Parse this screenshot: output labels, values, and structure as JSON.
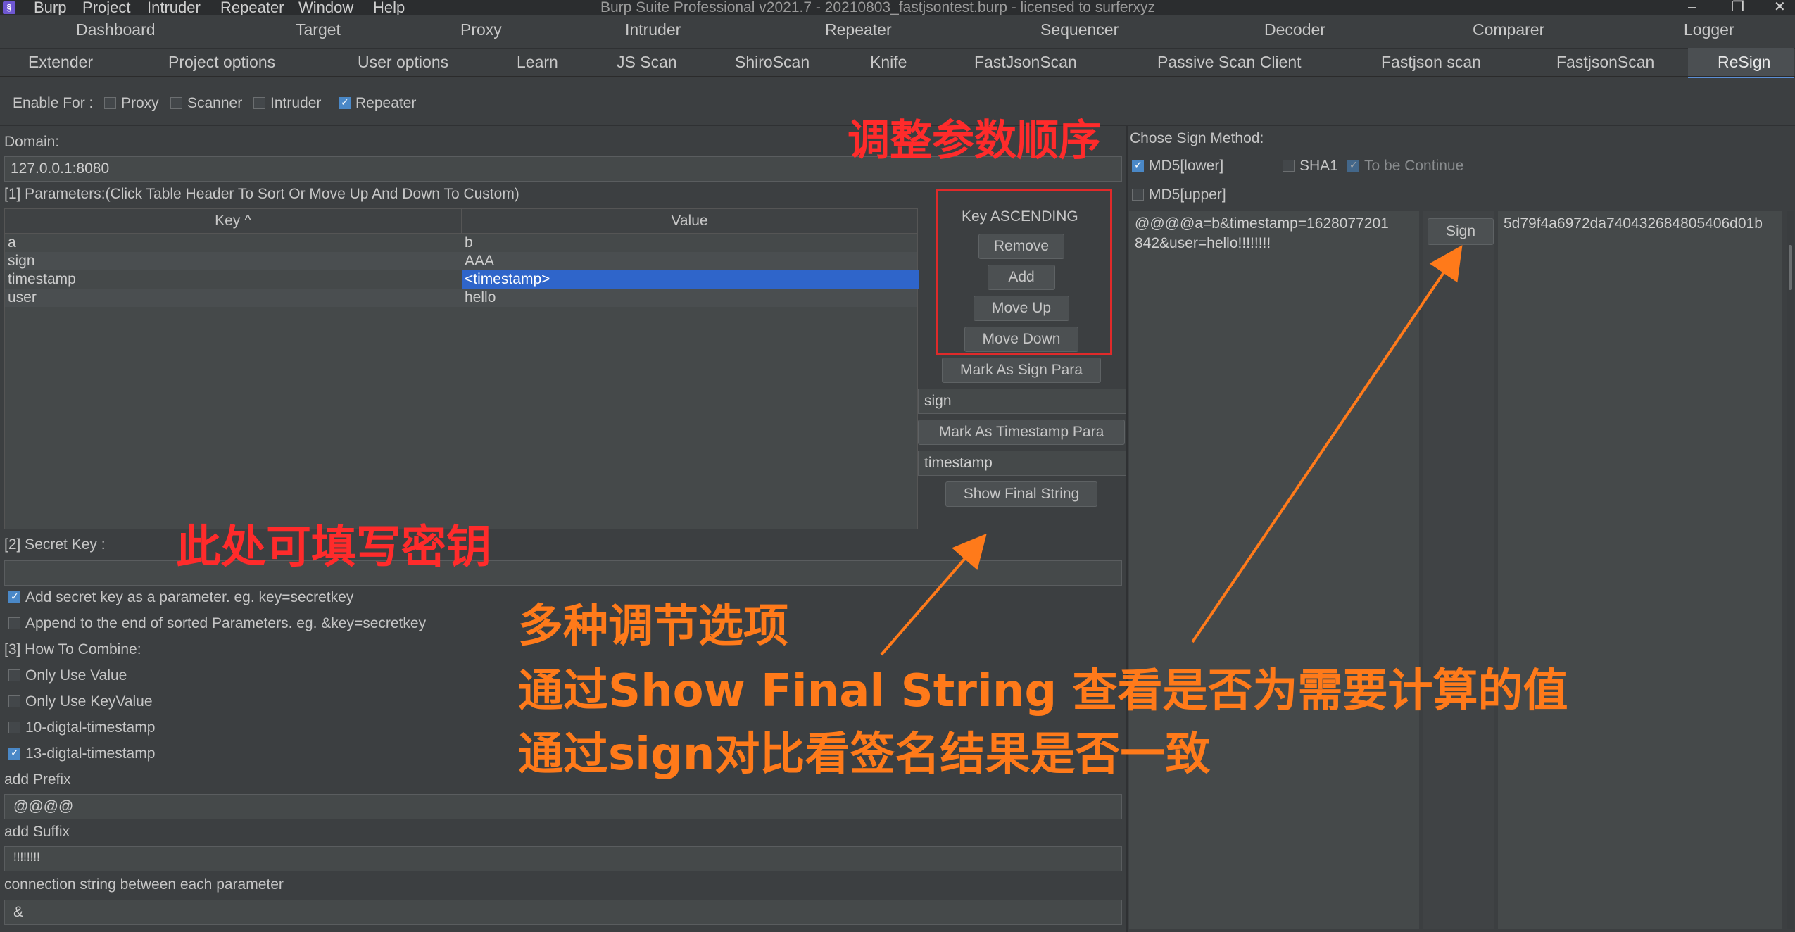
{
  "app": {
    "menu": [
      "Burp",
      "Project",
      "Intruder",
      "Repeater",
      "Window",
      "Help"
    ],
    "title": "Burp Suite Professional v2021.7 - 20210803_fastjsontest.burp - licensed to surferxyz",
    "window_controls": [
      "–",
      "❐",
      "✕"
    ]
  },
  "tabs_row1": [
    "Dashboard",
    "Target",
    "Proxy",
    "Intruder",
    "Repeater",
    "Sequencer",
    "Decoder",
    "Comparer",
    "Logger"
  ],
  "tabs_row2": [
    "Extender",
    "Project options",
    "User options",
    "Learn",
    "JS Scan",
    "ShiroScan",
    "Knife",
    "FastJsonScan",
    "Passive Scan Client",
    "Fastjson scan",
    "FastjsonScan",
    "ReSign"
  ],
  "enable_for": {
    "label": "Enable For :",
    "options": [
      {
        "label": "Proxy",
        "checked": false
      },
      {
        "label": "Scanner",
        "checked": false
      },
      {
        "label": "Intruder",
        "checked": false
      },
      {
        "label": "Repeater",
        "checked": true
      }
    ]
  },
  "domain": {
    "label": "Domain:",
    "value": "127.0.0.1:8080"
  },
  "parameters": {
    "label": "[1] Parameters:(Click Table Header To Sort Or Move Up And Down To Custom)",
    "columns": [
      "Key ^",
      "Value"
    ],
    "rows": [
      {
        "key": "a",
        "value": "b"
      },
      {
        "key": "sign",
        "value": "AAA"
      },
      {
        "key": "timestamp",
        "value": "<timestamp>"
      },
      {
        "key": "user",
        "value": "hello"
      }
    ]
  },
  "side_controls": {
    "sort_label": "Key ASCENDING",
    "remove": "Remove",
    "add": "Add",
    "move_up": "Move Up",
    "move_down": "Move Down",
    "mark_sign": "Mark As Sign Para",
    "sign_para": "sign",
    "mark_timestamp": "Mark As Timestamp Para",
    "timestamp_para": "timestamp",
    "show_final": "Show Final String"
  },
  "secret": {
    "label": "[2] Secret Key :",
    "value": "",
    "opt_param": {
      "label": "Add secret key as a parameter. eg. key=secretkey",
      "checked": true
    },
    "opt_append": {
      "label": "Append to the end of sorted Parameters. eg. &key=secretkey",
      "checked": false
    }
  },
  "combine": {
    "label": "[3] How To Combine:",
    "options": [
      {
        "label": "Only Use Value",
        "checked": false
      },
      {
        "label": "Only Use KeyValue",
        "checked": false
      },
      {
        "label": "10-digtal-timestamp",
        "checked": false
      },
      {
        "label": "13-digtal-timestamp",
        "checked": true
      }
    ],
    "prefix_label": "add Prefix",
    "prefix_value": "@@@@",
    "suffix_label": "add Suffix",
    "suffix_value": "!!!!!!!!",
    "conn_label": "connection string between each parameter",
    "conn_value": "&"
  },
  "sign_method": {
    "label": "Chose Sign Method:",
    "options": [
      {
        "label": "MD5[lower]",
        "checked": true
      },
      {
        "label": "SHA1",
        "checked": false
      },
      {
        "label": "To be Continue",
        "checked": true
      },
      {
        "label": "MD5[upper]",
        "checked": false
      }
    ],
    "final_string_line1": "@@@@a=b&timestamp=1628077201",
    "final_string_line2": "842&user=hello!!!!!!!!",
    "sign_button": "Sign",
    "result": "5d79f4a6972da740432684805406d01b"
  },
  "annotations": {
    "order": "调整参数顺序",
    "secret": "此处可填写密钥",
    "line1": "多种调节选项",
    "line2": "通过Show Final String 查看是否为需要计算的值",
    "line3": "通过sign对比看签名结果是否一致"
  },
  "colors": {
    "annotation_red": "#ff2b2b",
    "annotation_orange": "#ff7a1a",
    "selection": "#2f65ca"
  }
}
